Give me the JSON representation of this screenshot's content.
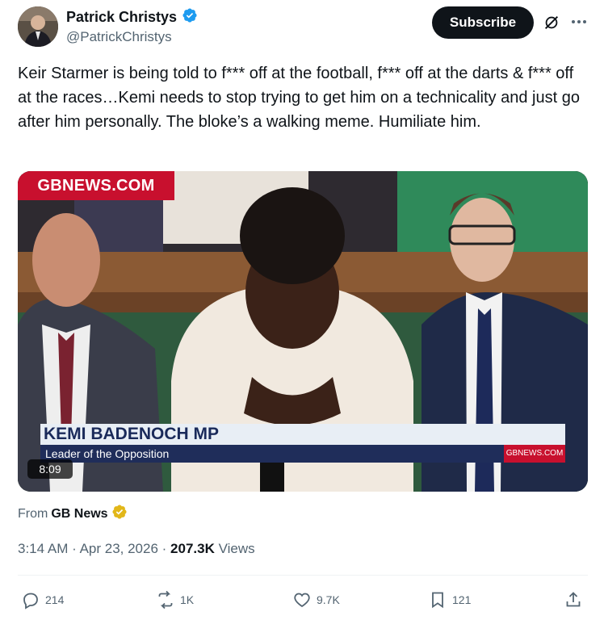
{
  "author": {
    "display_name": "Patrick Christys",
    "handle": "@PatrickChristys",
    "verified_color": "#1d9bf0"
  },
  "header": {
    "subscribe_label": "Subscribe",
    "grok_icon": "grok-icon",
    "more_icon": "more-icon"
  },
  "tweet": {
    "text": "Keir Starmer is being told to f*** off at the football, f*** off at the darts & f*** off at the races…Kemi needs to stop trying to get him on a technicality and just go after him personally. The bloke’s a walking meme. Humiliate him."
  },
  "media": {
    "channel_logo": "GBNEWS.COM",
    "lower_third_name": "KEMI BADENOCH MP",
    "lower_third_role": "Leader of the Opposition",
    "lower_third_site": "GBNEWS.COM",
    "duration": "8:09",
    "brand_red": "#c8102e",
    "lower_third_navy": "#1f2d5a"
  },
  "source": {
    "prefix": "From",
    "name": "GB News",
    "badge_color": "#e2b719"
  },
  "meta": {
    "time": "3:14 AM",
    "date": "Apr 23, 2026",
    "views_count": "207.3K",
    "views_label": "Views"
  },
  "actions": {
    "replies": "214",
    "reposts": "1K",
    "likes": "9.7K",
    "bookmarks": "121"
  }
}
